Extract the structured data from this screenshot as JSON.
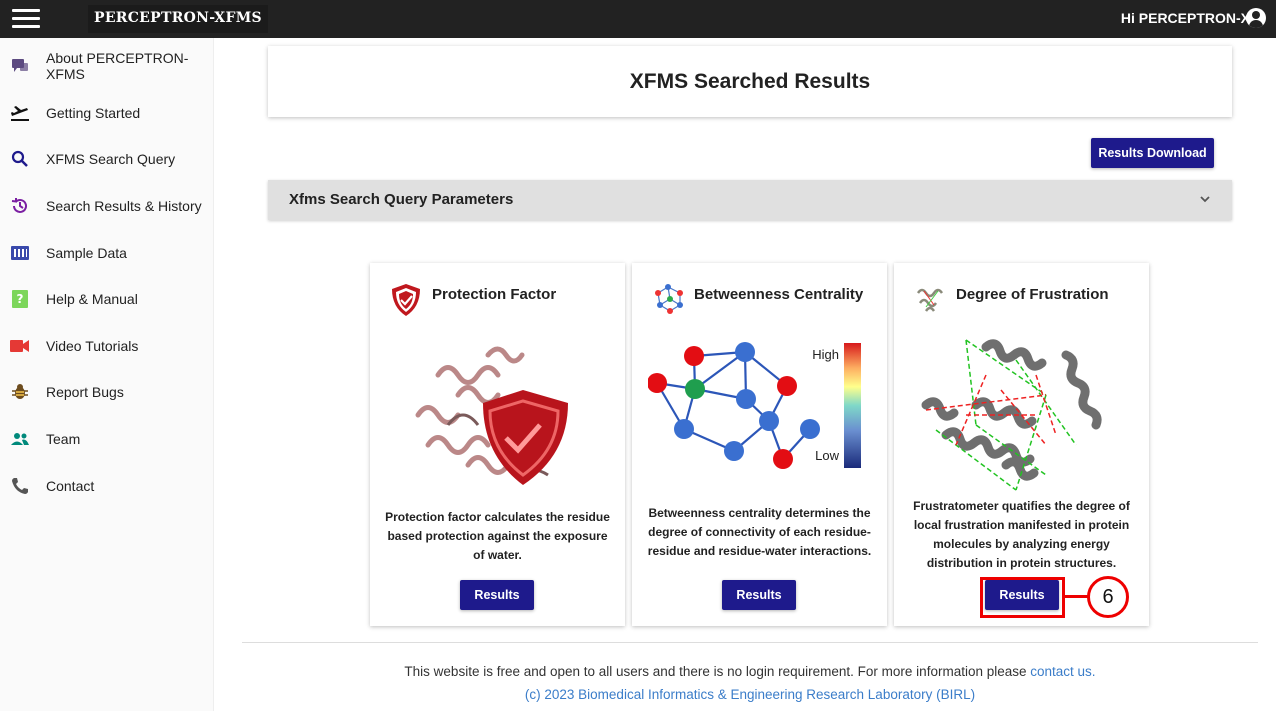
{
  "header": {
    "logo_text": "PERCEPTRON-XFMS",
    "greeting": "Hi PERCEPTRON-X"
  },
  "sidebar": {
    "items": [
      {
        "label": "About PERCEPTRON-XFMS",
        "icon": "chat-bubbles-icon",
        "color": "#5c4a80"
      },
      {
        "label": "Getting Started",
        "icon": "airplane-takeoff-icon",
        "color": "#111111"
      },
      {
        "label": "XFMS Search Query",
        "icon": "search-icon",
        "color": "#1e1a8c"
      },
      {
        "label": "Search Results & History",
        "icon": "history-icon",
        "color": "#7b1fa2"
      },
      {
        "label": "Sample Data",
        "icon": "data-grid-icon",
        "color": "#3949ab"
      },
      {
        "label": "Help & Manual",
        "icon": "help-icon",
        "color": "#7cd65a"
      },
      {
        "label": "Video Tutorials",
        "icon": "video-camera-icon",
        "color": "#e53935"
      },
      {
        "label": "Report Bugs",
        "icon": "bug-icon",
        "color": "#6d4c1e"
      },
      {
        "label": "Team",
        "icon": "team-icon",
        "color": "#00897b"
      },
      {
        "label": "Contact",
        "icon": "phone-icon",
        "color": "#555555"
      }
    ]
  },
  "main": {
    "title": "XFMS Searched Results",
    "download_label": "Results Download",
    "accordion_title": "Xfms Search Query Parameters",
    "cards": [
      {
        "title": "Protection Factor",
        "description": "Protection factor calculates the residue based protection against the exposure of water.",
        "button": "Results"
      },
      {
        "title": "Betweenness Centrality",
        "description": "Betweenness centrality determines the degree of connectivity of each residue-residue and residue-water interactions.",
        "button": "Results",
        "legend_high": "High",
        "legend_low": "Low"
      },
      {
        "title": "Degree of Frustration",
        "description": "Frustratometer quatifies the degree of local frustration manifested in protein molecules by analyzing energy distribution in protein structures.",
        "button": "Results"
      }
    ],
    "callout_number": "6"
  },
  "footer": {
    "text": "This website is free and open to all users and there is no login requirement. For more information please",
    "link": "contact us.",
    "copyright": "(c) 2023 Biomedical Informatics & Engineering Research Laboratory (BIRL)"
  },
  "colors": {
    "brand_button": "#1e1a8c",
    "highlight": "#e00000",
    "link": "#3b7dc9"
  }
}
